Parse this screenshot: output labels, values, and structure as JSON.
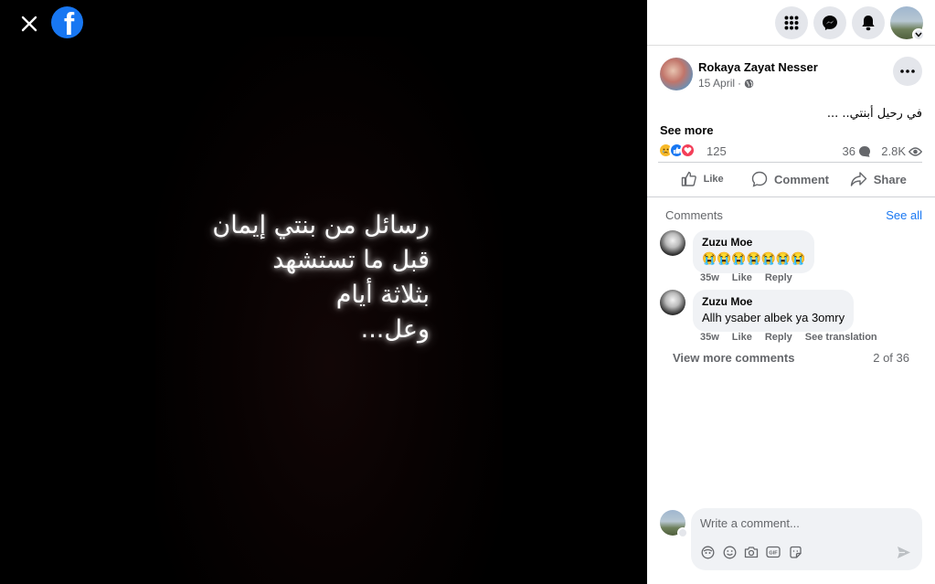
{
  "viewer": {
    "photo_lines": [
      "رسائل من بنتي إيمان",
      "قبل ما تستشهد",
      "بثلاثة أيام",
      "وعل..."
    ],
    "close_icon": "close-icon",
    "logo": "facebook-logo"
  },
  "topbar": {
    "icons": [
      "menu-grid-icon",
      "messenger-icon",
      "notifications-bell-icon",
      "account-avatar"
    ]
  },
  "post": {
    "author": "Rokaya Zayat Nesser",
    "date": "15 April",
    "separator": "·",
    "audience_icon": "globe-icon",
    "text": "في رحيل أبنتي.. ...",
    "see_more": "See more",
    "reaction_count": "125",
    "comments_count": "36",
    "views_count": "2.8K"
  },
  "actions": {
    "like": "Like",
    "comment": "Comment",
    "share": "Share"
  },
  "comments_section": {
    "title": "Comments",
    "see_all": "See all",
    "items": [
      {
        "name": "Zuzu Moe",
        "text": "😭😭😭😭😭😭😭",
        "time": "35w",
        "like": "Like",
        "reply": "Reply",
        "see_translation": ""
      },
      {
        "name": "Zuzu Moe",
        "text": "Allh ysaber albek ya 3omry",
        "time": "35w",
        "like": "Like",
        "reply": "Reply",
        "see_translation": "See translation"
      }
    ],
    "view_more": "View more comments",
    "pager": "2 of 36"
  },
  "composer": {
    "placeholder": "Write a comment..."
  },
  "colors": {
    "brand": "#1877f2",
    "panel_bg": "#ffffff",
    "bubble_bg": "#f0f2f5",
    "secondary_text": "#65676b"
  }
}
